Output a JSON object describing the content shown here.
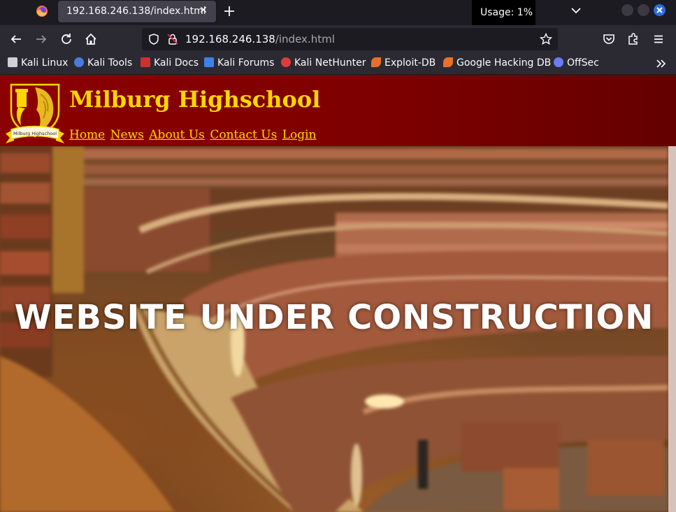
{
  "browser": {
    "tab_title": "192.168.246.138/index.html",
    "tab_close": "✕",
    "usage_tooltip": "Usage: 1%",
    "url_host": "192.168.246.138",
    "url_path": "/index.html",
    "bookmarks": [
      {
        "label": "Kali Linux",
        "icon": "kali-dragon-icon",
        "color": "#cfcfd4"
      },
      {
        "label": "Kali Tools",
        "icon": "kali-tools-icon",
        "color": "#4a7bdc"
      },
      {
        "label": "Kali Docs",
        "icon": "kali-docs-icon",
        "color": "#d22f2f"
      },
      {
        "label": "Kali Forums",
        "icon": "kali-forums-icon",
        "color": "#3c82e8"
      },
      {
        "label": "Kali NetHunter",
        "icon": "kali-nethunter-icon",
        "color": "#e23a3a"
      },
      {
        "label": "Exploit-DB",
        "icon": "exploit-db-icon",
        "color": "#e8702a"
      },
      {
        "label": "Google Hacking DB",
        "icon": "ghdb-icon",
        "color": "#e8702a"
      },
      {
        "label": "OffSec",
        "icon": "offsec-icon",
        "color": "#6b7bff"
      }
    ]
  },
  "site": {
    "title": "Milburg Highschool",
    "logo_ribbon_text": "Milburg Highschool",
    "nav": [
      "Home",
      "News",
      "About Us",
      "Contact Us",
      "Login"
    ],
    "hero_heading": "WEBSITE UNDER CONSTRUCTION",
    "header_color": "#8b0000",
    "accent_color": "#ffd700"
  }
}
